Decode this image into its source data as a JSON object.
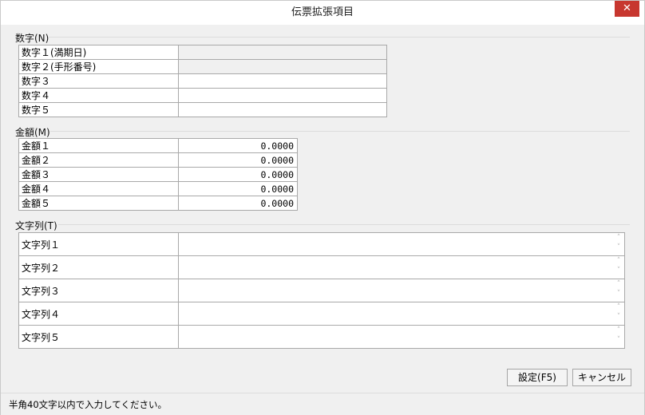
{
  "window": {
    "title": "伝票拡張項目",
    "close_glyph": "✕"
  },
  "numbers": {
    "heading": "数字(N)",
    "rows": [
      {
        "label": "数字１(満期日)",
        "value": ""
      },
      {
        "label": "数字２(手形番号)",
        "value": ""
      },
      {
        "label": "数字３",
        "value": ""
      },
      {
        "label": "数字４",
        "value": ""
      },
      {
        "label": "数字５",
        "value": ""
      }
    ]
  },
  "amounts": {
    "heading": "金額(M)",
    "rows": [
      {
        "label": "金額１",
        "value": "0.0000"
      },
      {
        "label": "金額２",
        "value": "0.0000"
      },
      {
        "label": "金額３",
        "value": "0.0000"
      },
      {
        "label": "金額４",
        "value": "0.0000"
      },
      {
        "label": "金額５",
        "value": "0.0000"
      }
    ]
  },
  "strings": {
    "heading": "文字列(T)",
    "rows": [
      {
        "label": "文字列１",
        "value": ""
      },
      {
        "label": "文字列２",
        "value": ""
      },
      {
        "label": "文字列３",
        "value": ""
      },
      {
        "label": "文字列４",
        "value": ""
      },
      {
        "label": "文字列５",
        "value": ""
      }
    ]
  },
  "buttons": {
    "settings": "設定(F5)",
    "cancel": "キャンセル"
  },
  "status": "半角40文字以内で入力してください。"
}
